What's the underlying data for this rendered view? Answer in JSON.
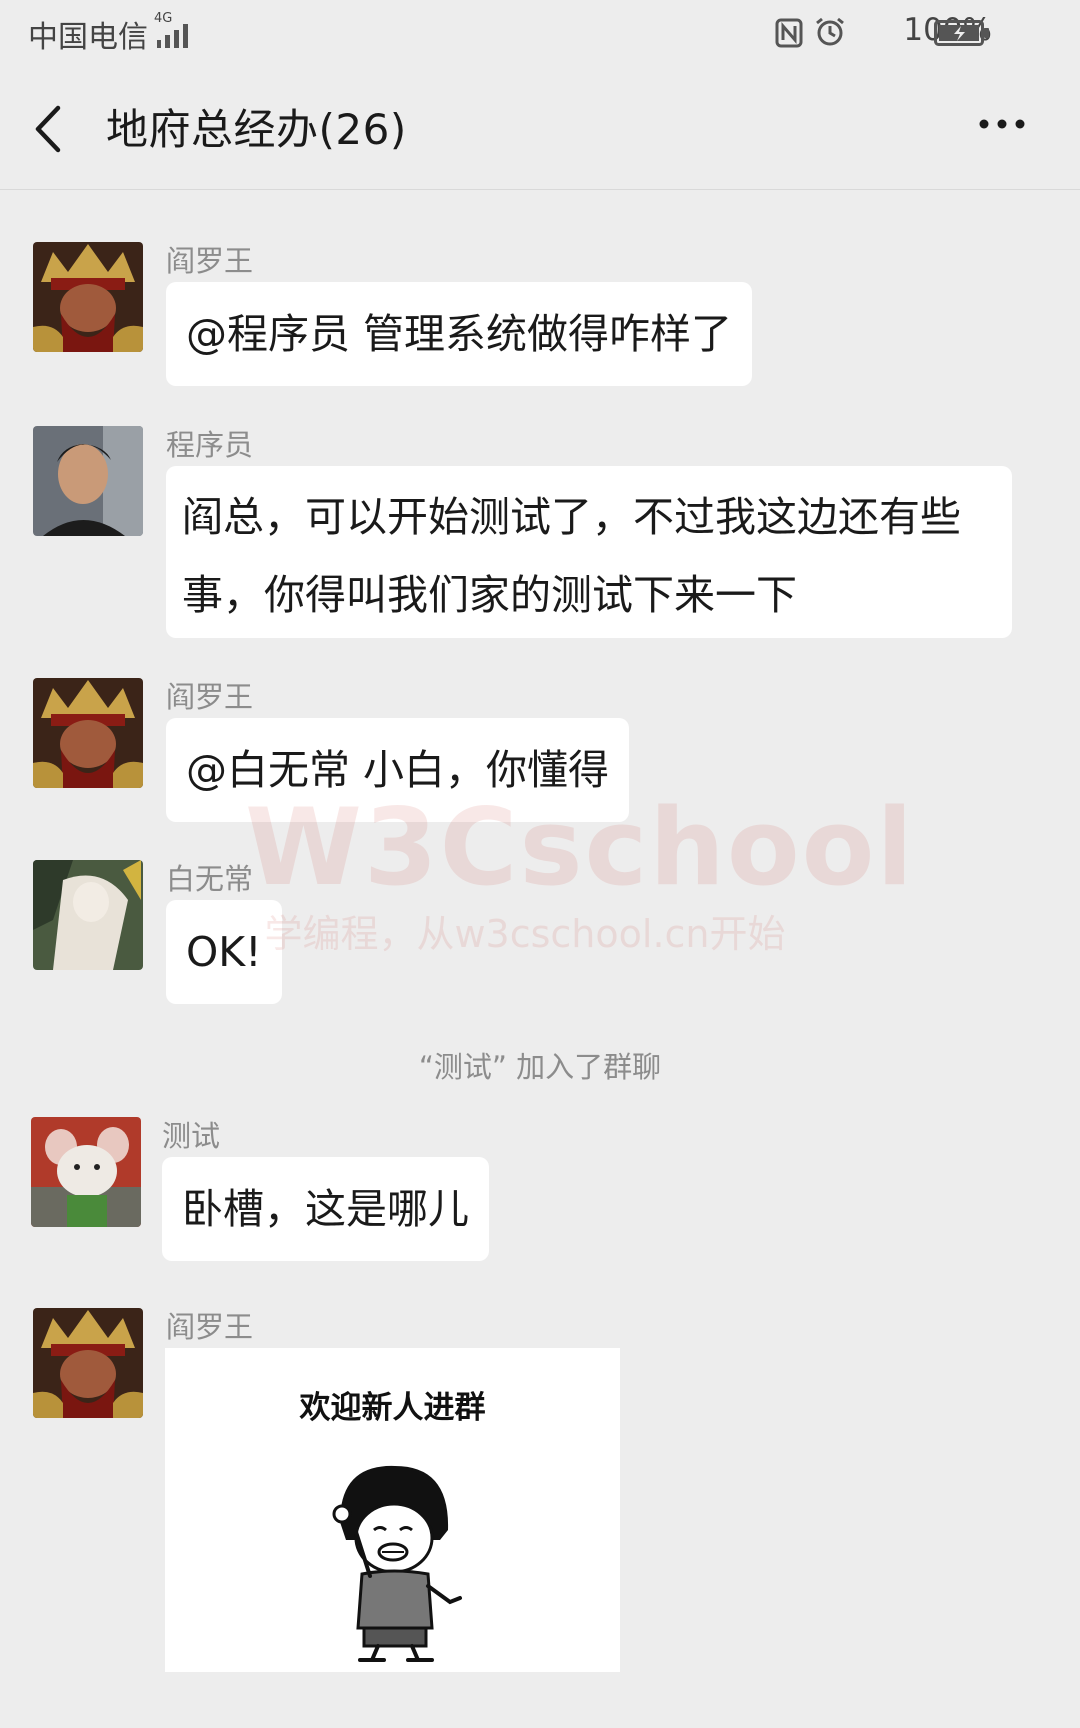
{
  "status_bar": {
    "carrier": "中国电信",
    "network_type": "4G",
    "battery_percent": "100%",
    "icons": [
      "signal-icon",
      "nfc-icon",
      "alarm-icon",
      "battery-charging-icon"
    ]
  },
  "header": {
    "title": "地府总经办(26)",
    "back_icon": "back-chevron-icon",
    "more_icon": "more-dots-icon"
  },
  "messages": [
    {
      "sender": "阎罗王",
      "avatar": "yanluo-avatar",
      "text": "@程序员 管理系统做得咋样了"
    },
    {
      "sender": "程序员",
      "avatar": "programmer-avatar",
      "text": "阎总，可以开始测试了，不过我这边还有些事，你得叫我们家的测试下来一下"
    },
    {
      "sender": "阎罗王",
      "avatar": "yanluo-avatar",
      "text": "@白无常 小白，你懂得"
    },
    {
      "sender": "白无常",
      "avatar": "baiwuchang-avatar",
      "text": "OK!"
    },
    {
      "sender": "测试",
      "avatar": "tester-mouse-avatar",
      "text": "卧槽，这是哪儿"
    },
    {
      "sender": "阎罗王",
      "avatar": "yanluo-avatar",
      "sticker_caption": "欢迎新人进群"
    }
  ],
  "system_notice": "“测试”  加入了群聊",
  "watermark": {
    "title": "W3Cschool",
    "subtitle": "学编程，从w3cschool.cn开始"
  },
  "colors": {
    "background": "#ededed",
    "bubble": "#ffffff",
    "sender_name": "#8c8c8c",
    "watermark": "#c8382c"
  }
}
